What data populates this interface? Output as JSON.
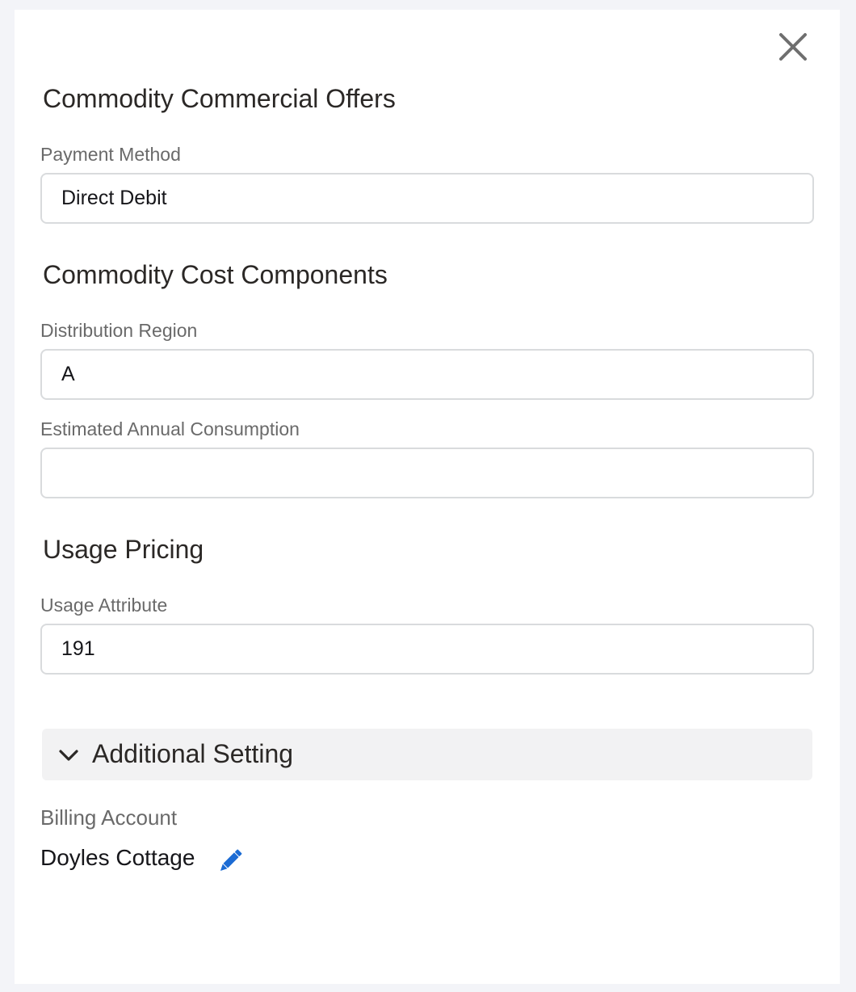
{
  "modal": {
    "close_icon": "close-icon"
  },
  "sections": {
    "commercial_offers_title": "Commodity Commercial Offers",
    "cost_components_title": "Commodity Cost Components",
    "usage_pricing_title": "Usage Pricing"
  },
  "fields": {
    "payment_method": {
      "label": "Payment Method",
      "value": "Direct Debit"
    },
    "distribution_region": {
      "label": "Distribution Region",
      "value": "A"
    },
    "estimated_annual_consumption": {
      "label": "Estimated Annual Consumption",
      "value": ""
    },
    "usage_attribute": {
      "label": "Usage Attribute",
      "value": "191"
    }
  },
  "additional_setting": {
    "label": "Additional Setting",
    "icon": "chevron-down-icon",
    "billing_account": {
      "label": "Billing Account",
      "value": "Doyles Cottage",
      "edit_icon": "pencil-icon"
    }
  },
  "colors": {
    "page_background": "#f3f4f8",
    "panel_background": "#ffffff",
    "accent_icon": "#1b6bd4",
    "accordion_background": "#f2f2f3"
  }
}
